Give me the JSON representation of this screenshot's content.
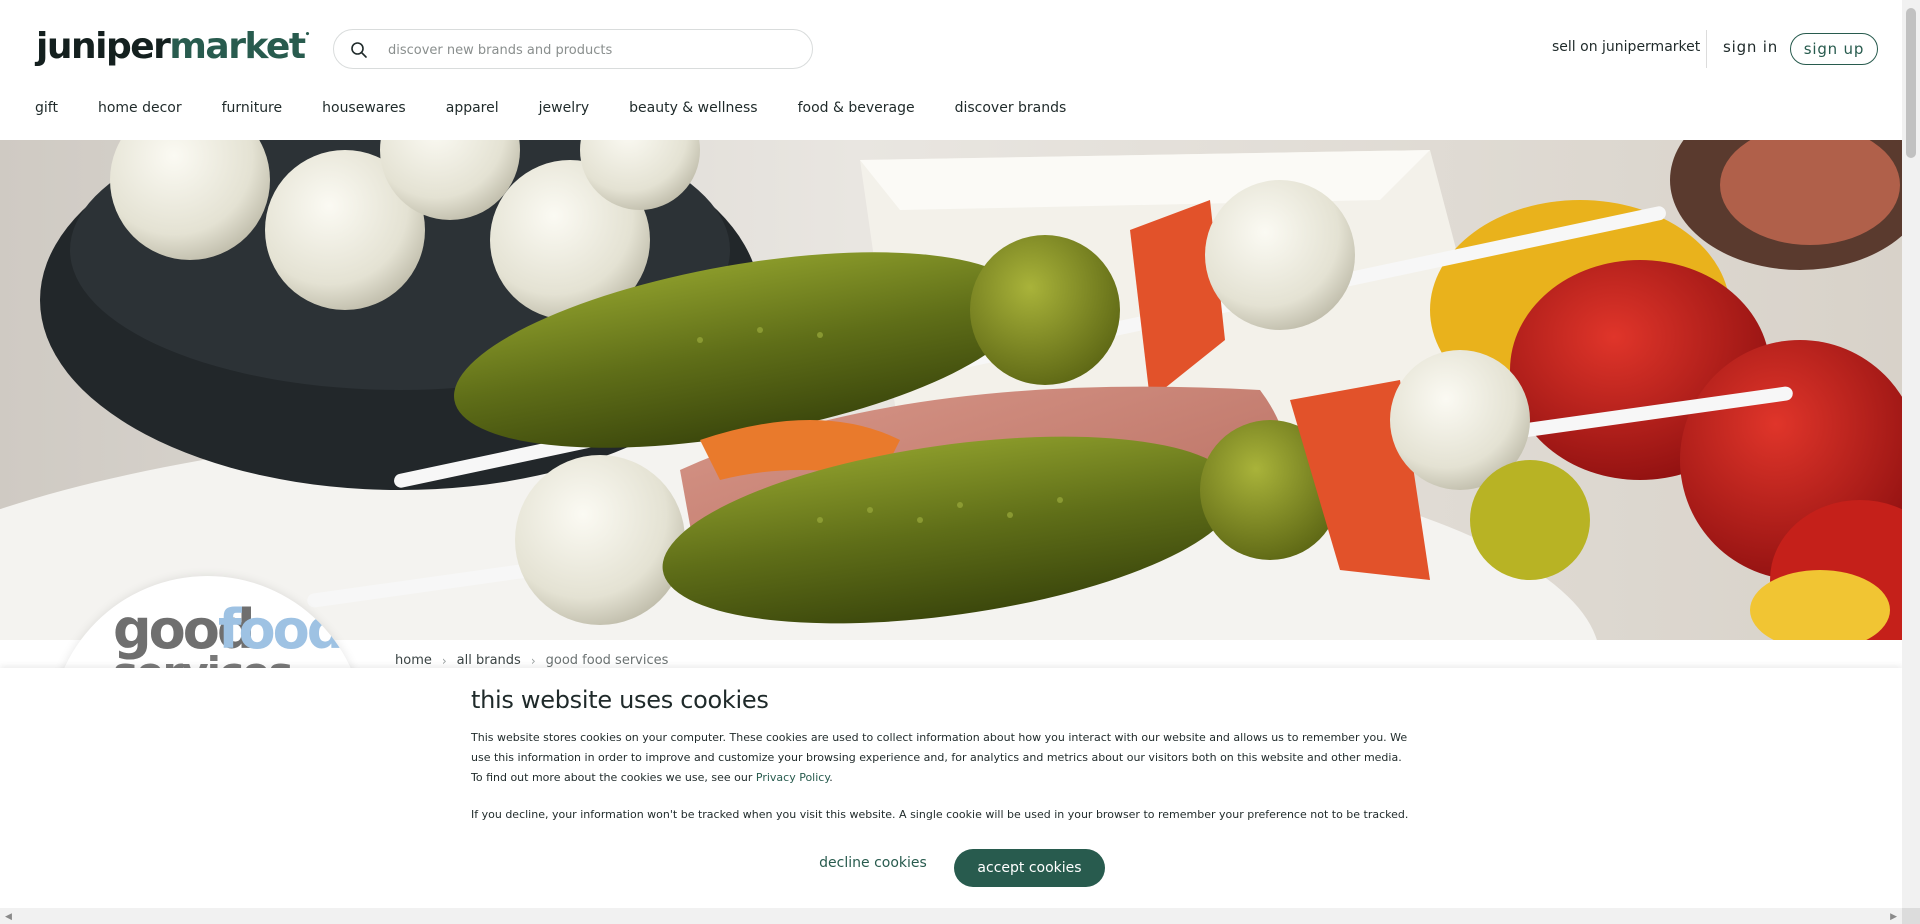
{
  "header": {
    "logo_part1": "juniper",
    "logo_part2": "market",
    "search_placeholder": "discover new brands and products",
    "sell_link": "sell on junipermarket",
    "sign_in": "sign in",
    "sign_up": "sign up"
  },
  "nav": {
    "items": [
      {
        "label": "gift"
      },
      {
        "label": "home decor"
      },
      {
        "label": "furniture"
      },
      {
        "label": "housewares"
      },
      {
        "label": "apparel"
      },
      {
        "label": "jewelry"
      },
      {
        "label": "beauty & wellness"
      },
      {
        "label": "food & beverage"
      },
      {
        "label": "discover brands"
      }
    ]
  },
  "brand": {
    "logo_word1": "good",
    "logo_word2": "food",
    "logo_word3": "services"
  },
  "breadcrumb": {
    "home": "home",
    "all_brands": "all brands",
    "current": "good food services"
  },
  "cookie": {
    "title": "this website uses cookies",
    "text1": "This website stores cookies on your computer. These cookies are used to collect information about how you interact with our website and allows us to remember you. We use this information in order to improve and customize your browsing experience and, for analytics and metrics about our visitors both on this website and other media. To find out more about the cookies we use, see our ",
    "privacy_link": "Privacy Policy",
    "text1_end": ".",
    "text2": "If you decline, your information won't be tracked when you visit this website. A single cookie will be used in your browser to remember your preference not to be tracked.",
    "decline": "decline cookies",
    "accept": "accept cookies"
  },
  "colors": {
    "brand_green": "#285b4e",
    "text_dark": "#1f2a2a"
  },
  "icons": {
    "search": "search-icon"
  }
}
